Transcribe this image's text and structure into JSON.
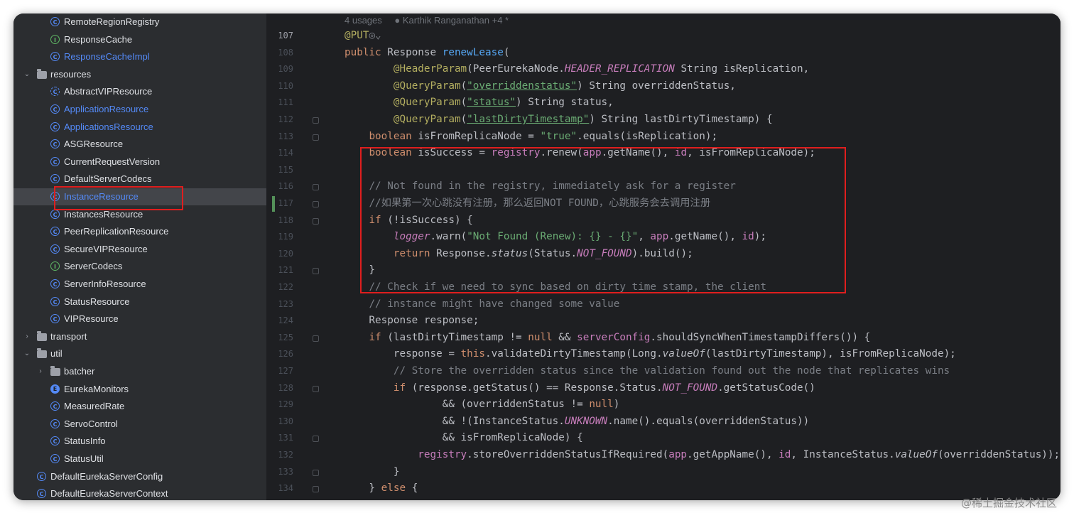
{
  "tree": [
    {
      "label": "RemoteRegionRegistry",
      "icon": "class-icon",
      "indent": 2,
      "muted": false
    },
    {
      "label": "ResponseCache",
      "icon": "interface-icon",
      "indent": 2,
      "muted": false
    },
    {
      "label": "ResponseCacheImpl",
      "icon": "class-icon",
      "indent": 2,
      "muted": true
    },
    {
      "label": "resources",
      "icon": "folder-icon",
      "indent": 1,
      "expanded": true
    },
    {
      "label": "AbstractVIPResource",
      "icon": "abstract-class-icon",
      "indent": 2,
      "muted": false
    },
    {
      "label": "ApplicationResource",
      "icon": "class-icon",
      "indent": 2,
      "muted": true
    },
    {
      "label": "ApplicationsResource",
      "icon": "class-icon",
      "indent": 2,
      "muted": true
    },
    {
      "label": "ASGResource",
      "icon": "class-icon",
      "indent": 2,
      "muted": false
    },
    {
      "label": "CurrentRequestVersion",
      "icon": "class-icon",
      "indent": 2,
      "muted": false
    },
    {
      "label": "DefaultServerCodecs",
      "icon": "class-icon",
      "indent": 2,
      "muted": false
    },
    {
      "label": "InstanceResource",
      "icon": "class-icon",
      "indent": 2,
      "muted": true,
      "selected": true
    },
    {
      "label": "InstancesResource",
      "icon": "class-icon",
      "indent": 2,
      "muted": false
    },
    {
      "label": "PeerReplicationResource",
      "icon": "class-icon",
      "indent": 2,
      "muted": false
    },
    {
      "label": "SecureVIPResource",
      "icon": "class-icon",
      "indent": 2,
      "muted": false
    },
    {
      "label": "ServerCodecs",
      "icon": "interface-icon",
      "indent": 2,
      "muted": false
    },
    {
      "label": "ServerInfoResource",
      "icon": "class-icon",
      "indent": 2,
      "muted": false
    },
    {
      "label": "StatusResource",
      "icon": "class-icon",
      "indent": 2,
      "muted": false
    },
    {
      "label": "VIPResource",
      "icon": "class-icon",
      "indent": 2,
      "muted": false
    },
    {
      "label": "transport",
      "icon": "folder-icon",
      "indent": 1,
      "expanded": false
    },
    {
      "label": "util",
      "icon": "folder-icon",
      "indent": 1,
      "expanded": true
    },
    {
      "label": "batcher",
      "icon": "folder-icon",
      "indent": 2,
      "expanded": false
    },
    {
      "label": "EurekaMonitors",
      "icon": "enum-icon",
      "indent": 2,
      "muted": false
    },
    {
      "label": "MeasuredRate",
      "icon": "class-icon",
      "indent": 2,
      "muted": false
    },
    {
      "label": "ServoControl",
      "icon": "class-icon",
      "indent": 2,
      "muted": false
    },
    {
      "label": "StatusInfo",
      "icon": "class-icon",
      "indent": 2,
      "muted": false
    },
    {
      "label": "StatusUtil",
      "icon": "class-icon",
      "indent": 2,
      "muted": false
    },
    {
      "label": "DefaultEurekaServerConfig",
      "icon": "class-icon",
      "indent": 1,
      "muted": false
    },
    {
      "label": "DefaultEurekaServerContext",
      "icon": "class-icon",
      "indent": 1,
      "muted": false
    }
  ],
  "editor": {
    "usage_hint": "4 usages",
    "author_hint": "Karthik Ranganathan +4 *",
    "current_line": "107",
    "changed_line": "117",
    "fold_lines": [
      "112",
      "113",
      "116",
      "117",
      "118",
      "121",
      "125",
      "128",
      "131",
      "133",
      "134"
    ],
    "lines": [
      {
        "n": "107",
        "segs": [
          [
            "ann",
            "@PUT"
          ],
          [
            "cmt",
            "◎⌄"
          ]
        ]
      },
      {
        "n": "108",
        "segs": [
          [
            "kw",
            "public "
          ],
          [
            "",
            "Response "
          ],
          [
            "fn",
            "renewLease"
          ],
          [
            "",
            "("
          ]
        ]
      },
      {
        "n": "109",
        "segs": [
          [
            "",
            "        "
          ],
          [
            "ann",
            "@HeaderParam"
          ],
          [
            "",
            "(PeerEurekaNode."
          ],
          [
            "const",
            "HEADER_REPLICATION"
          ],
          [
            "",
            " String isReplication,"
          ]
        ]
      },
      {
        "n": "110",
        "segs": [
          [
            "",
            "        "
          ],
          [
            "ann",
            "@QueryParam"
          ],
          [
            "",
            "("
          ],
          [
            "str und",
            "\"overriddenstatus\""
          ],
          [
            "",
            ") String overriddenStatus,"
          ]
        ]
      },
      {
        "n": "111",
        "segs": [
          [
            "",
            "        "
          ],
          [
            "ann",
            "@QueryParam"
          ],
          [
            "",
            "("
          ],
          [
            "str und",
            "\"status\""
          ],
          [
            "",
            ") String status,"
          ]
        ]
      },
      {
        "n": "112",
        "segs": [
          [
            "",
            "        "
          ],
          [
            "ann",
            "@QueryParam"
          ],
          [
            "",
            "("
          ],
          [
            "str und",
            "\"lastDirtyTimestamp\""
          ],
          [
            "",
            ") String lastDirtyTimestamp) {"
          ]
        ]
      },
      {
        "n": "113",
        "segs": [
          [
            "",
            "    "
          ],
          [
            "kw",
            "boolean "
          ],
          [
            "",
            "isFromReplicaNode = "
          ],
          [
            "str",
            "\"true\""
          ],
          [
            "",
            ".equals(isReplication);"
          ]
        ]
      },
      {
        "n": "114",
        "segs": [
          [
            "",
            "    "
          ],
          [
            "kw",
            "boolean "
          ],
          [
            "",
            "isSuccess = "
          ],
          [
            "fld",
            "registry"
          ],
          [
            "",
            ".renew("
          ],
          [
            "fld",
            "app"
          ],
          [
            "",
            ".getName(), "
          ],
          [
            "fld",
            "id"
          ],
          [
            "",
            ", isFromReplicaNode);"
          ]
        ]
      },
      {
        "n": "115",
        "segs": [
          [
            "",
            ""
          ]
        ]
      },
      {
        "n": "116",
        "segs": [
          [
            "",
            "    "
          ],
          [
            "cmt",
            "// Not found in the registry, immediately ask for a register"
          ]
        ]
      },
      {
        "n": "117",
        "segs": [
          [
            "",
            "    "
          ],
          [
            "cmt",
            "//如果第一次心跳没有注册，那么返回NOT FOUND，心跳服务会去调用注册"
          ]
        ]
      },
      {
        "n": "118",
        "segs": [
          [
            "",
            "    "
          ],
          [
            "kw",
            "if "
          ],
          [
            "",
            "(!isSuccess) {"
          ]
        ]
      },
      {
        "n": "119",
        "segs": [
          [
            "",
            "        "
          ],
          [
            "fld ital",
            "logger"
          ],
          [
            "",
            ".warn("
          ],
          [
            "str",
            "\"Not Found (Renew): {} - {}\""
          ],
          [
            "",
            ", "
          ],
          [
            "fld",
            "app"
          ],
          [
            "",
            ".getName(), "
          ],
          [
            "fld",
            "id"
          ],
          [
            "",
            ");"
          ]
        ]
      },
      {
        "n": "120",
        "segs": [
          [
            "",
            "        "
          ],
          [
            "kw",
            "return "
          ],
          [
            "",
            "Response."
          ],
          [
            "ital",
            "status"
          ],
          [
            "",
            "(Status."
          ],
          [
            "const",
            "NOT_FOUND"
          ],
          [
            "",
            ").build();"
          ]
        ]
      },
      {
        "n": "121",
        "segs": [
          [
            "",
            "    }"
          ]
        ]
      },
      {
        "n": "122",
        "segs": [
          [
            "",
            "    "
          ],
          [
            "cmt",
            "// Check if we need to sync based on dirty time stamp, the client"
          ]
        ]
      },
      {
        "n": "123",
        "segs": [
          [
            "",
            "    "
          ],
          [
            "cmt",
            "// instance might have changed some value"
          ]
        ]
      },
      {
        "n": "124",
        "segs": [
          [
            "",
            "    Response response;"
          ]
        ]
      },
      {
        "n": "125",
        "segs": [
          [
            "",
            "    "
          ],
          [
            "kw",
            "if "
          ],
          [
            "",
            "(lastDirtyTimestamp != "
          ],
          [
            "kw",
            "null "
          ],
          [
            "",
            "&& "
          ],
          [
            "fld",
            "serverConfig"
          ],
          [
            "",
            ".shouldSyncWhenTimestampDiffers()) {"
          ]
        ]
      },
      {
        "n": "126",
        "segs": [
          [
            "",
            "        response = "
          ],
          [
            "kw",
            "this"
          ],
          [
            "",
            ".validateDirtyTimestamp(Long."
          ],
          [
            "ital",
            "valueOf"
          ],
          [
            "",
            "(lastDirtyTimestamp), isFromReplicaNode);"
          ]
        ]
      },
      {
        "n": "127",
        "segs": [
          [
            "",
            "        "
          ],
          [
            "cmt",
            "// Store the overridden status since the validation found out the node that replicates wins"
          ]
        ]
      },
      {
        "n": "128",
        "segs": [
          [
            "",
            "        "
          ],
          [
            "kw",
            "if "
          ],
          [
            "",
            "(response.getStatus() == Response.Status."
          ],
          [
            "const",
            "NOT_FOUND"
          ],
          [
            "",
            ".getStatusCode()"
          ]
        ]
      },
      {
        "n": "129",
        "segs": [
          [
            "",
            "                && (overriddenStatus != "
          ],
          [
            "kw",
            "null"
          ],
          [
            "",
            ")"
          ]
        ]
      },
      {
        "n": "130",
        "segs": [
          [
            "",
            "                && !(InstanceStatus."
          ],
          [
            "const",
            "UNKNOWN"
          ],
          [
            "",
            ".name().equals(overriddenStatus))"
          ]
        ]
      },
      {
        "n": "131",
        "segs": [
          [
            "",
            "                && isFromReplicaNode) {"
          ]
        ]
      },
      {
        "n": "132",
        "segs": [
          [
            "",
            "            "
          ],
          [
            "fld",
            "registry"
          ],
          [
            "",
            ".storeOverriddenStatusIfRequired("
          ],
          [
            "fld",
            "app"
          ],
          [
            "",
            ".getAppName(), "
          ],
          [
            "fld",
            "id"
          ],
          [
            "",
            ", InstanceStatus."
          ],
          [
            "ital",
            "valueOf"
          ],
          [
            "",
            "(overriddenStatus));"
          ]
        ]
      },
      {
        "n": "133",
        "segs": [
          [
            "",
            "        }"
          ]
        ]
      },
      {
        "n": "134",
        "segs": [
          [
            "",
            "    } "
          ],
          [
            "kw",
            "else "
          ],
          [
            "",
            "{"
          ]
        ]
      }
    ]
  },
  "watermark": "@稀土掘金技术社区"
}
